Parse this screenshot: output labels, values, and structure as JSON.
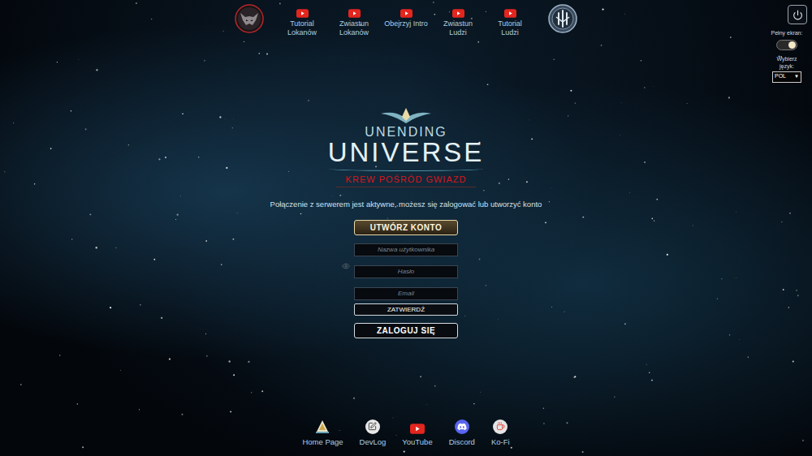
{
  "top_nav": [
    {
      "lines": [
        "Tutorial",
        "Lokanów"
      ]
    },
    {
      "lines": [
        "Zwiastun",
        "Lokanów"
      ]
    },
    {
      "lines": [
        "Obejrzyj Intro"
      ]
    },
    {
      "lines": [
        "Zwiastun",
        "Ludzi"
      ]
    },
    {
      "lines": [
        "Tutorial",
        "Ludzi"
      ]
    }
  ],
  "settings": {
    "fullscreen_label": "Pełny ekran:",
    "fullscreen_on": true,
    "language_label": "Wybierz język:",
    "language_value": "POL",
    "language_arrow": "▼"
  },
  "logo": {
    "top": "UNENDING",
    "main": "UNIVERSE",
    "subtitle": "KREW POŚRÓD GWIAZD"
  },
  "status_message": "Połączenie z serwerem jest aktywne, możesz się zalogować lub utworzyć konto",
  "form": {
    "create_button": {
      "label": "UTWÓRZ KONTO",
      "active": true
    },
    "fields": [
      {
        "placeholder": "Nazwa użytkownika",
        "kind": "text"
      },
      {
        "placeholder": "Hasło",
        "kind": "password"
      },
      {
        "placeholder": "Email",
        "kind": "text"
      }
    ],
    "submit": "ZATWIERDŹ",
    "login": "ZALOGUJ SIĘ"
  },
  "footer_links": [
    {
      "label": "Home Page",
      "kind": "home"
    },
    {
      "label": "DevLog",
      "kind": "devlog"
    },
    {
      "label": "YouTube",
      "kind": "youtube"
    },
    {
      "label": "Discord",
      "kind": "discord"
    },
    {
      "label": "Ko-Fi",
      "kind": "kofi"
    }
  ]
}
